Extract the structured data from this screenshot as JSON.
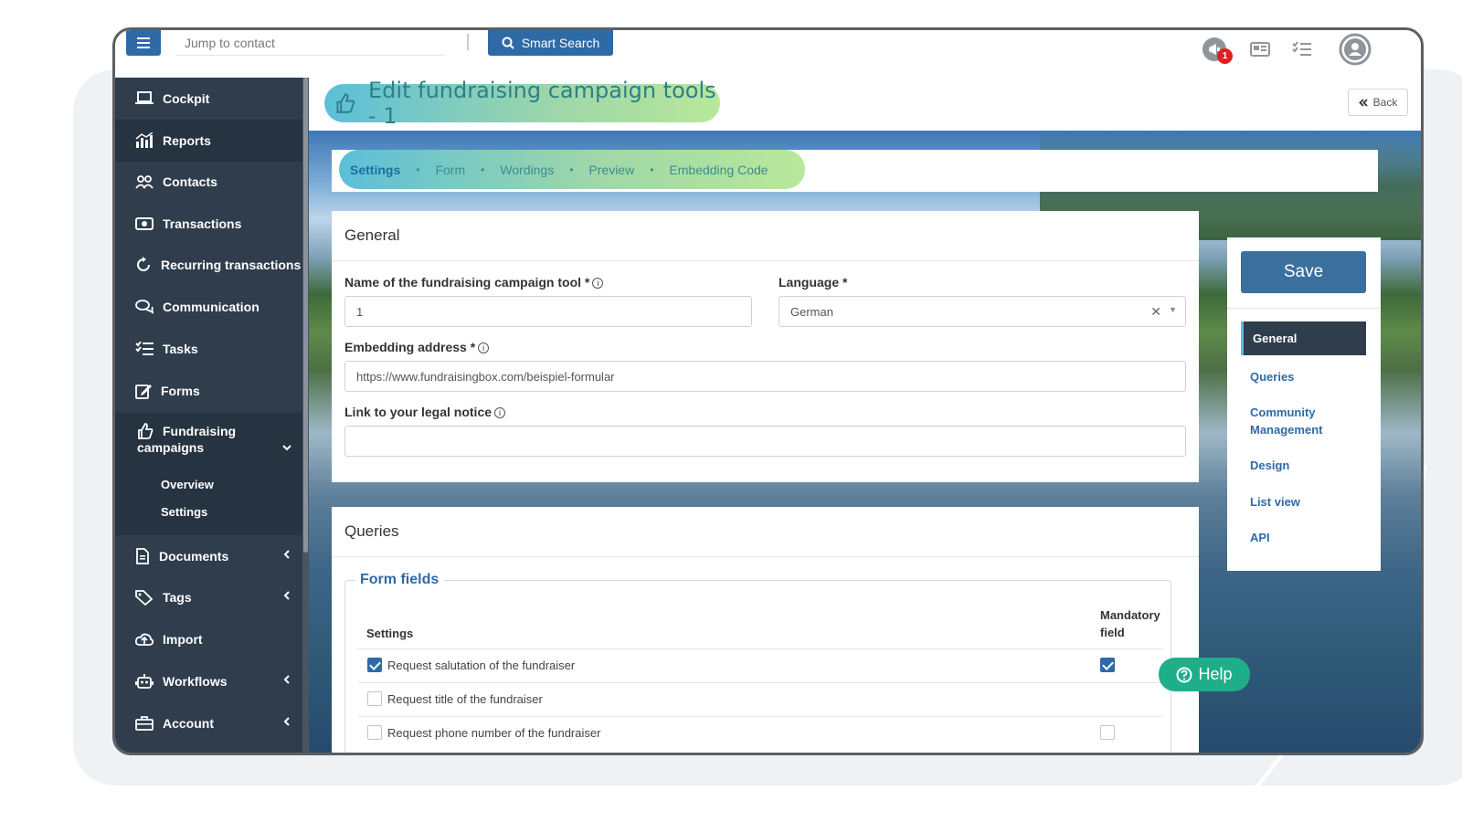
{
  "topbar": {
    "jump_placeholder": "Jump to contact",
    "smart_search": "Smart Search",
    "notification_count": "1"
  },
  "sidebar": {
    "items": [
      {
        "label": "Cockpit",
        "icon": "laptop-icon"
      },
      {
        "label": "Reports",
        "icon": "chart-icon"
      },
      {
        "label": "Contacts",
        "icon": "users-icon"
      },
      {
        "label": "Transactions",
        "icon": "money-icon"
      },
      {
        "label": "Recurring transactions",
        "icon": "recurring-icon"
      },
      {
        "label": "Communication",
        "icon": "chat-icon"
      },
      {
        "label": "Tasks",
        "icon": "tasks-icon"
      },
      {
        "label": "Forms",
        "icon": "edit-icon"
      },
      {
        "label": "Fundraising campaigns",
        "icon": "thumbs-up-icon"
      },
      {
        "label": "Documents",
        "icon": "document-icon"
      },
      {
        "label": "Tags",
        "icon": "tag-icon"
      },
      {
        "label": "Import",
        "icon": "upload-icon"
      },
      {
        "label": "Workflows",
        "icon": "robot-icon"
      },
      {
        "label": "Account",
        "icon": "briefcase-icon"
      }
    ],
    "fundraising_line1": "Fundraising",
    "fundraising_line2": "campaigns",
    "sub_items": [
      "Overview",
      "Settings"
    ]
  },
  "page": {
    "title": "Edit fundraising campaign tools - 1",
    "back_label": "Back"
  },
  "tabs": [
    "Settings",
    "Form",
    "Wordings",
    "Preview",
    "Embedding Code"
  ],
  "general": {
    "heading": "General",
    "name_label": "Name of the fundraising campaign tool *",
    "name_value": "1",
    "language_label": "Language *",
    "language_value": "German",
    "embedding_label": "Embedding address *",
    "embedding_value": "https://www.fundraisingbox.com/beispiel-formular",
    "legal_label": "Link to your legal notice",
    "legal_value": ""
  },
  "queries": {
    "heading": "Queries",
    "fieldset_legend": "Form fields",
    "col_settings": "Settings",
    "col_mandatory_line1": "Mandatory",
    "col_mandatory_line2": "field",
    "rows": [
      {
        "label": "Request salutation of the fundraiser",
        "checked": true,
        "mandatory": true
      },
      {
        "label": "Request title of the fundraiser",
        "checked": false,
        "mandatory": null
      },
      {
        "label": "Request phone number of the fundraiser",
        "checked": false,
        "mandatory": false
      }
    ]
  },
  "rightpanel": {
    "save_label": "Save",
    "active": "General",
    "items": [
      "Queries",
      "Community Management",
      "Design",
      "List view",
      "API"
    ]
  },
  "help_label": "Help",
  "colors": {
    "primary": "#2e6aa6",
    "sidebar": "#2f3d4c",
    "help": "#1fae8a"
  }
}
